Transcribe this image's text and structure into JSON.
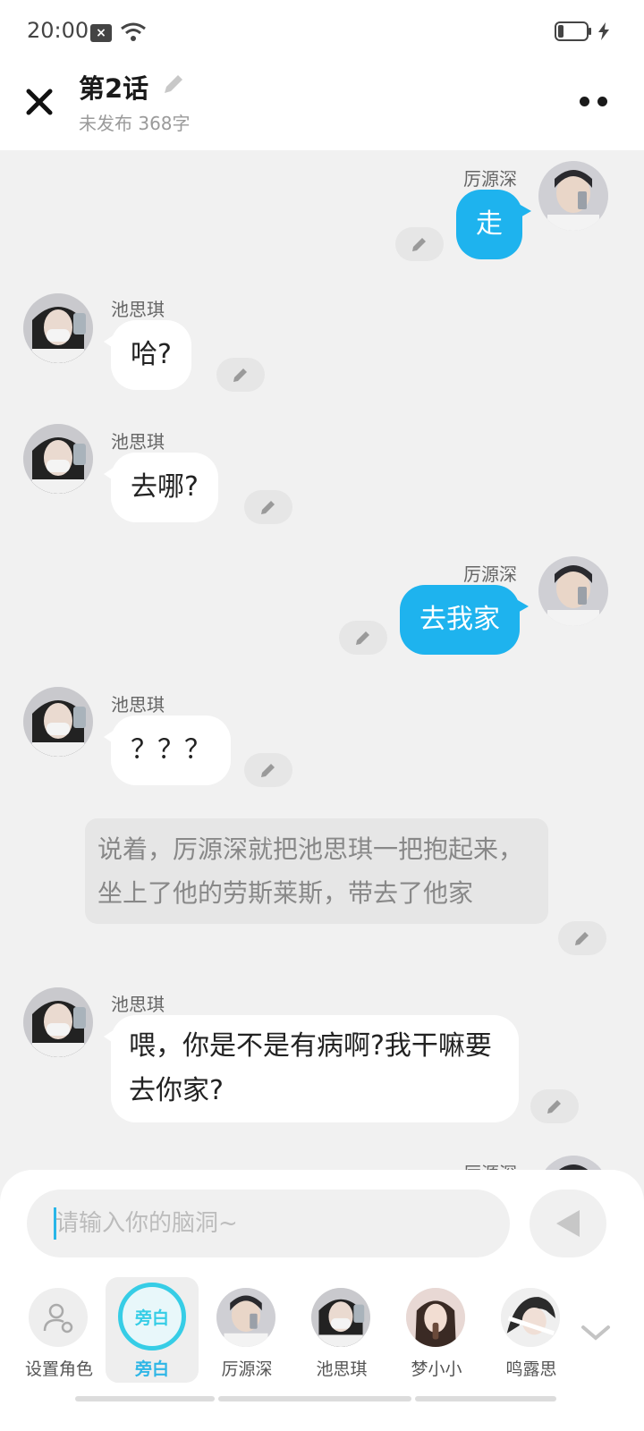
{
  "status_bar": {
    "time": "20:00"
  },
  "header": {
    "title": "第2话",
    "subtitle": "未发布 368字"
  },
  "messages": {
    "m1": {
      "speaker": "厉源深",
      "text": "走"
    },
    "m2": {
      "speaker": "池思琪",
      "text": "哈?"
    },
    "m3": {
      "speaker": "池思琪",
      "text": "去哪?"
    },
    "m4": {
      "speaker": "厉源深",
      "text": "去我家"
    },
    "m5": {
      "speaker": "池思琪",
      "text": "？？？"
    },
    "m6": {
      "text": "说着，厉源深就把池思琪一把抱起来，坐上了他的劳斯莱斯，带去了他家"
    },
    "m7": {
      "speaker": "池思琪",
      "text": "喂，你是不是有病啊?我干嘛要去你家?"
    },
    "m8": {
      "speaker": "厉源深"
    }
  },
  "composer": {
    "placeholder": "请输入你的脑洞~"
  },
  "roles": {
    "set_role": "设置角色",
    "narration_badge": "旁白",
    "narration": "旁白",
    "r1": "厉源深",
    "r2": "池思琪",
    "r3": "梦小小",
    "r4": "鸣露思"
  },
  "colors": {
    "accent": "#1eb3ee",
    "narration_ring": "#36cde6"
  }
}
